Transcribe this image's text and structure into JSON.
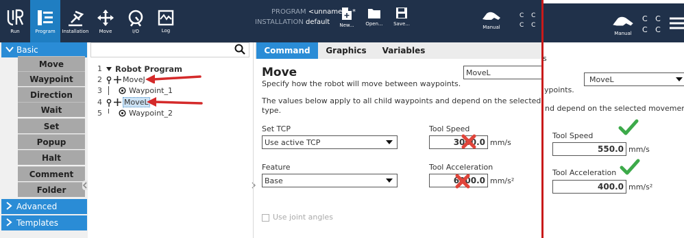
{
  "topbar": {
    "nav": [
      {
        "label": "Run",
        "icon": "ur-logo-icon"
      },
      {
        "label": "Program",
        "icon": "program-icon"
      },
      {
        "label": "Installation",
        "icon": "installation-icon"
      },
      {
        "label": "Move",
        "icon": "move-icon"
      },
      {
        "label": "I/O",
        "icon": "io-icon"
      },
      {
        "label": "Log",
        "icon": "log-icon"
      }
    ],
    "program_key": "PROGRAM",
    "program_value": "<unnamed>*",
    "installation_key": "INSTALLATION",
    "installation_value": "default",
    "file_buttons": [
      {
        "label": "New...",
        "icon": "new-file-icon"
      },
      {
        "label": "Open...",
        "icon": "folder-icon"
      },
      {
        "label": "Save...",
        "icon": "save-icon"
      }
    ],
    "manual_label": "Manual",
    "speed_text_1": "C C",
    "speed_text_2": "C C"
  },
  "sidebar": {
    "basic": "Basic",
    "items": [
      "Move",
      "Waypoint",
      "Direction",
      "Wait",
      "Set",
      "Popup",
      "Halt",
      "Comment",
      "Folder"
    ],
    "advanced": "Advanced",
    "templates": "Templates"
  },
  "tree": {
    "search_placeholder": "",
    "rows": [
      {
        "num": "1",
        "text": "Robot Program"
      },
      {
        "num": "2",
        "text": "MoveJ"
      },
      {
        "num": "3",
        "text": "Waypoint_1"
      },
      {
        "num": "4",
        "text": "MoveL"
      },
      {
        "num": "5",
        "text": "Waypoint_2"
      }
    ]
  },
  "tabs": [
    "Command",
    "Graphics",
    "Variables"
  ],
  "panel": {
    "title": "Move",
    "move_type": "MoveL",
    "subtitle": "Specify how the robot will move between waypoints.",
    "desc_line1": "The values below apply to all child waypoints and depend on the selected moveme",
    "desc_line2": "type.",
    "set_tcp_label": "Set TCP",
    "set_tcp_value": "Use active TCP",
    "feature_label": "Feature",
    "feature_value": "Base",
    "tool_speed_label": "Tool Speed",
    "tool_speed_value": "3000.0",
    "tool_speed_unit": "mm/s",
    "tool_accel_label": "Tool Acceleration",
    "tool_accel_value": "6000.0",
    "tool_accel_unit": "mm/s²",
    "joint_angles_label": "Use joint angles"
  },
  "overlay": {
    "manual_label": "Manual",
    "speed_text_1": "C C",
    "speed_text_2": "C C",
    "partial_s": "s",
    "move_type": "MoveL",
    "line1": "ypoints.",
    "line2": "nd depend on the selected movement",
    "tool_speed_label": "Tool Speed",
    "tool_speed_value": "550.0",
    "tool_speed_unit": "mm/s",
    "tool_accel_label": "Tool Acceleration",
    "tool_accel_value": "400.0",
    "tool_accel_unit": "mm/s²"
  },
  "colors": {
    "topbar": "#20314a",
    "accent": "#2a8cd6",
    "arrow_red": "#d42a2a",
    "check_green": "#3daa4a",
    "cross_red": "#e0443a"
  }
}
